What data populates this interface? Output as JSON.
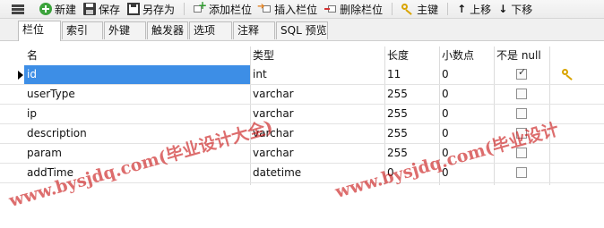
{
  "toolbar": {
    "new_label": "新建",
    "save_label": "保存",
    "save_as_label": "另存为",
    "add_column_label": "添加栏位",
    "insert_column_label": "插入栏位",
    "delete_column_label": "删除栏位",
    "primary_key_label": "主键",
    "move_up_label": "上移",
    "move_down_label": "下移"
  },
  "tabs": [
    {
      "label": "栏位",
      "active": true
    },
    {
      "label": "索引"
    },
    {
      "label": "外键"
    },
    {
      "label": "触发器"
    },
    {
      "label": "选项"
    },
    {
      "label": "注释"
    },
    {
      "label": "SQL 预览"
    }
  ],
  "grid": {
    "headers": {
      "name": "名",
      "type": "类型",
      "length": "长度",
      "decimals": "小数点",
      "not_null": "不是 null"
    },
    "rows": [
      {
        "name": "id",
        "type": "int",
        "length": "11",
        "decimals": "0",
        "not_null": true,
        "primary_key": true,
        "selected": true
      },
      {
        "name": "userType",
        "type": "varchar",
        "length": "255",
        "decimals": "0",
        "not_null": false
      },
      {
        "name": "ip",
        "type": "varchar",
        "length": "255",
        "decimals": "0",
        "not_null": false
      },
      {
        "name": "description",
        "type": "varchar",
        "length": "255",
        "decimals": "0",
        "not_null": false
      },
      {
        "name": "param",
        "type": "varchar",
        "length": "255",
        "decimals": "0",
        "not_null": false
      },
      {
        "name": "addTime",
        "type": "datetime",
        "length": "0",
        "decimals": "0",
        "not_null": false
      }
    ]
  },
  "watermark": {
    "text1": "www.bysjdq.com(毕业设计大全)",
    "text2": "www.bysjdq.com(毕业设计"
  },
  "colors": {
    "selection": "#3d8ee6",
    "watermark": "#c81414"
  }
}
